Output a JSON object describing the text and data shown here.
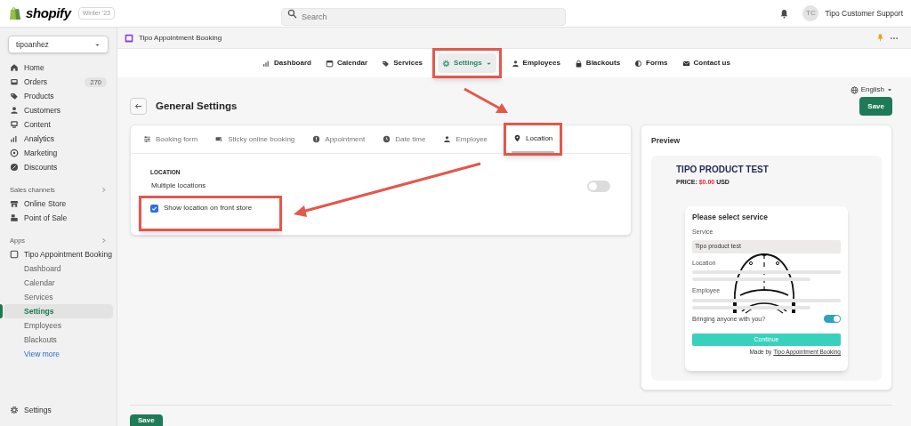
{
  "topbar": {
    "brand": "shopify",
    "edition": "Winter '23",
    "search": {
      "placeholder": "Search"
    },
    "user": {
      "initials": "TC",
      "name": "Tipo Customer Support"
    }
  },
  "sidebar": {
    "store": "tipoanhez",
    "items": [
      {
        "label": "Home"
      },
      {
        "label": "Orders",
        "badge": "270"
      },
      {
        "label": "Products"
      },
      {
        "label": "Customers"
      },
      {
        "label": "Content"
      },
      {
        "label": "Analytics"
      },
      {
        "label": "Marketing"
      },
      {
        "label": "Discounts"
      }
    ],
    "sales_channels": {
      "title": "Sales channels",
      "items": [
        {
          "label": "Online Store"
        },
        {
          "label": "Point of Sale"
        }
      ]
    },
    "apps": {
      "title": "Apps",
      "app": "Tipo Appointment Booking",
      "children": [
        {
          "label": "Dashboard",
          "selected": false
        },
        {
          "label": "Calendar",
          "selected": false
        },
        {
          "label": "Services",
          "selected": false
        },
        {
          "label": "Settings",
          "selected": true
        },
        {
          "label": "Employees",
          "selected": false
        },
        {
          "label": "Blackouts",
          "selected": false
        }
      ],
      "more": "View more"
    },
    "settings": "Settings"
  },
  "app": {
    "title": "Tipo Appointment Booking",
    "nav": [
      {
        "label": "Dashboard",
        "selected": false,
        "highlighted": false
      },
      {
        "label": "Calendar",
        "selected": false,
        "highlighted": false
      },
      {
        "label": "Services",
        "selected": false,
        "highlighted": false
      },
      {
        "label": "Settings",
        "selected": true,
        "highlighted": true
      },
      {
        "label": "Employees",
        "selected": false,
        "highlighted": false
      },
      {
        "label": "Blackouts",
        "selected": false,
        "highlighted": false
      },
      {
        "label": "Forms",
        "selected": false,
        "highlighted": false
      },
      {
        "label": "Contact us",
        "selected": false,
        "highlighted": false
      }
    ],
    "language": "English",
    "page_title": "General Settings",
    "save": "Save",
    "tabs": [
      {
        "label": "Booking form",
        "selected": false,
        "highlighted": false
      },
      {
        "label": "Sticky online booking",
        "selected": false,
        "highlighted": false
      },
      {
        "label": "Appointment",
        "selected": false,
        "highlighted": false
      },
      {
        "label": "Date time",
        "selected": false,
        "highlighted": false
      },
      {
        "label": "Employee",
        "selected": false,
        "highlighted": false
      },
      {
        "label": "Location",
        "selected": true,
        "highlighted": true
      }
    ],
    "section_label": "LOCATION",
    "toggle": {
      "label": "Multiple locations",
      "on": false
    },
    "checkbox": {
      "label": "Show location on front store",
      "checked": true,
      "highlighted": true
    },
    "preview": {
      "title": "Preview",
      "product": "TIPO PRODUCT TEST",
      "price_label": "PRICE:",
      "price": "$0.00",
      "currency": "USD",
      "form": {
        "heading": "Please select service",
        "service_label": "Service",
        "service_value": "Tipo product test",
        "location_label": "Location",
        "employee_label": "Employee",
        "bringing_label": "Bringing anyone with you?",
        "bringing_on": true,
        "button": "Continue",
        "made_by": "Made by",
        "made_by_link": "Tipo Appointment Booking"
      }
    },
    "footer_save": "Save"
  }
}
